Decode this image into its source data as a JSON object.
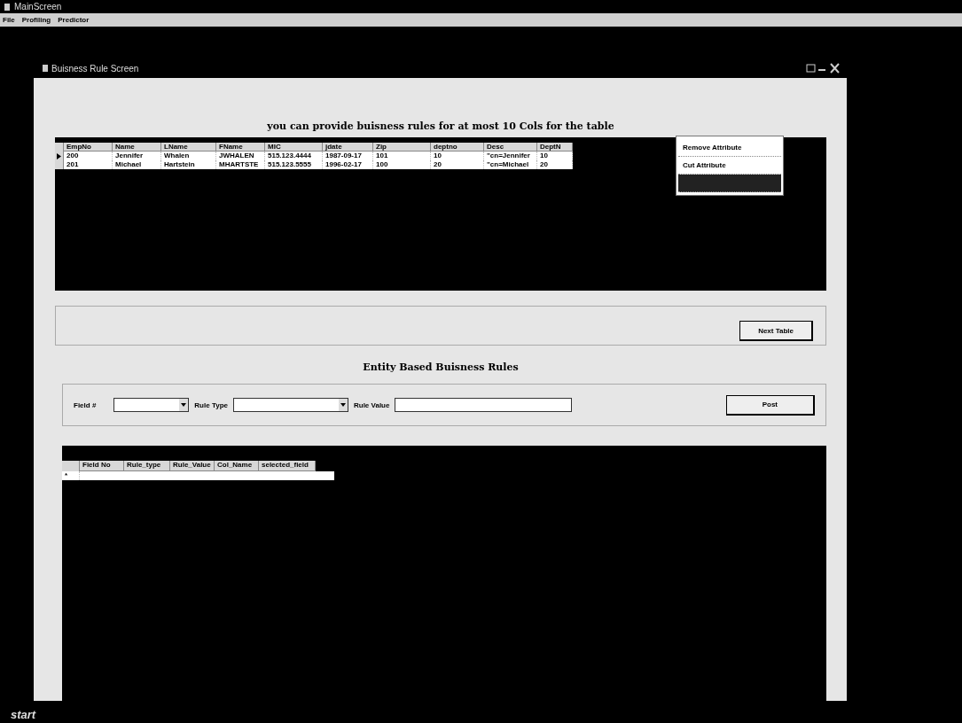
{
  "window": {
    "title": "MainScreen"
  },
  "menu": [
    "File",
    "Profiling",
    "Predictor"
  ],
  "child_window": {
    "title": "Buisness Rule Screen"
  },
  "heading": "you can provide buisness rules for at most 10 Cols for the table",
  "table": {
    "columns": [
      "EmpNo",
      "Name",
      "LName",
      "FName",
      "MIC",
      "jdate",
      "Zip",
      "deptno",
      "Desc",
      "DeptN"
    ],
    "rows": [
      {
        "current": true,
        "cells": [
          "200",
          "Jennifer",
          "Whalen",
          "JWHALEN",
          "515.123.4444",
          "1987-09-17",
          "101",
          "10",
          "\"cn=Jennifer",
          "10"
        ]
      },
      {
        "current": false,
        "cells": [
          "201",
          "Michael",
          "Hartstein",
          "MHARTSTE",
          "515.123.5555",
          "1996-02-17",
          "100",
          "20",
          "\"cn=Michael",
          "20"
        ]
      }
    ]
  },
  "context_menu": [
    {
      "label": "Remove Attribute",
      "selected": false
    },
    {
      "label": "Cut Attribute",
      "selected": false
    },
    {
      "selected": true
    }
  ],
  "next_button": "Next Table",
  "rules_heading": "Entity Based Buisness Rules",
  "form": {
    "field_label": "Field #",
    "rule_type_label": "Rule Type",
    "rule_value_label": "Rule Value",
    "post_button": "Post"
  },
  "rules_table": {
    "columns": [
      "Field No",
      "Rule_type",
      "Rule_Value",
      "Col_Name",
      "selected_field"
    ],
    "new_row_mark": "*"
  },
  "taskbar": {
    "start": "start"
  }
}
